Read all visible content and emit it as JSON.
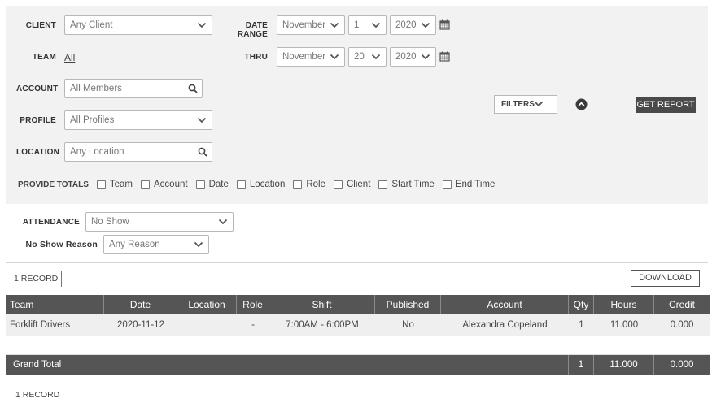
{
  "filters": {
    "client_label": "CLIENT",
    "client_value": "Any Client",
    "date_range_label": "DATE RANGE",
    "from_month": "November",
    "from_day": "1",
    "from_year": "2020",
    "team_label": "TEAM",
    "team_value": "All",
    "thru_label": "THRU",
    "thru_month": "November",
    "thru_day": "20",
    "thru_year": "2020",
    "account_label": "ACCOUNT",
    "account_placeholder": "All Members",
    "profile_label": "PROFILE",
    "profile_value": "All Profiles",
    "location_label": "LOCATION",
    "location_placeholder": "Any Location",
    "totals_label": "PROVIDE TOTALS",
    "totals_options": [
      "Team",
      "Account",
      "Date",
      "Location",
      "Role",
      "Client",
      "Start Time",
      "End Time"
    ],
    "filters_button": "FILTERS",
    "get_report_button": "GET REPORT"
  },
  "extra_filters": {
    "attendance_label": "ATTENDANCE",
    "attendance_value": "No Show",
    "no_show_reason_label": "No Show Reason",
    "no_show_reason_value": "Any Reason"
  },
  "results": {
    "record_count": "1 RECORD",
    "download_button": "DOWNLOAD",
    "columns": [
      "Team",
      "Date",
      "Location",
      "Role",
      "Shift",
      "Published",
      "Account",
      "Qty",
      "Hours",
      "Credit"
    ],
    "rows": [
      {
        "team": "Forklift Drivers",
        "date": "2020-11-12",
        "location": "",
        "role": "-",
        "shift": "7:00AM - 6:00PM",
        "published": "No",
        "account": "Alexandra Copeland",
        "qty": "1",
        "hours": "11.000",
        "credit": "0.000"
      }
    ],
    "grand_total": {
      "label": "Grand Total",
      "qty": "1",
      "hours": "11.000",
      "credit": "0.000"
    },
    "record_count_bottom": "1 RECORD"
  },
  "icons": {
    "calendar": "calendar-icon",
    "chevron": "chevron-down-icon",
    "search": "search-icon",
    "collapse": "chevron-up-circle-icon"
  }
}
